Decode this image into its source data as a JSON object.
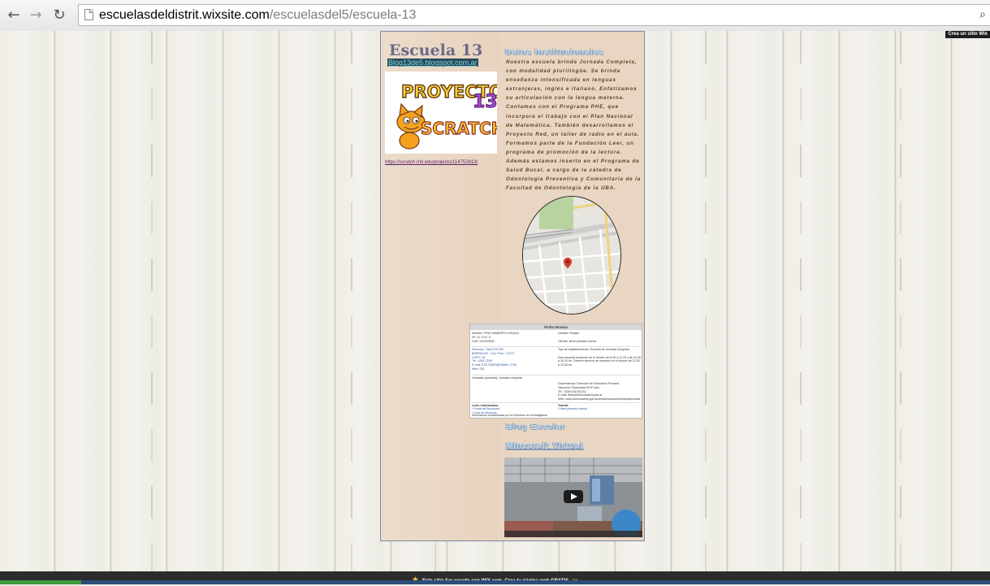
{
  "browser": {
    "back_icon": "arrow-left-icon",
    "forward_icon": "arrow-right-icon",
    "reload_icon": "reload-icon",
    "url_domain": "escuelasdeldistrit.wixsite.com",
    "url_path": "/escuelasdel5/escuela-13"
  },
  "site": {
    "title": "Escuela 13",
    "blog_link": "Blog13de5.blogspot.com.ar",
    "scratch_logo": {
      "line1": "PROYECTO",
      "number": "13",
      "line2": "SCRATCH"
    },
    "scratch_url": "https://scratch.mit.edu/projects/114752813/",
    "info_heading": "Datos institucionales",
    "description": "Nuestra escuela brinda Jornada Completa, con modalidad plurilingüe. Se brinda enseñanza intensificada en lenguas extranjeras, inglés e italiano. Enfatizamos su articulación con la lengua materna. Contamos con el Programa PHE, que incorpora el trabajo con el Plan Nacional de Matemática. También desarrollamos el Proyecto Red, un taller de radio en el aula. Formamos parte de la Fundación Leer, un programa de promoción de la lectura. Además estamos inserto en el Programa de Salud Bucal, a cargo de la cátedra de Odontología Preventiva y Comunitaria de la Facultad de Odontología de la UBA.",
    "map_pin_icon": "map-pin-icon",
    "ficha": {
      "header": "Ficha técnica",
      "left_top": "Nombre: FRAY MAMERTO ESQUIU\nNº: 13 / D.E. 5\nCUE: 020439000",
      "left_address": "Dirección: GALDOS 532\nBARRACAS - Cód. Post.: C1277\nCGPC: 04\nTel.: 4301-2299\nE-mail: ESC13DE5@GMAIL.COM\nWeb: S/D",
      "right_top": "Gestión: Estatal\n\nOfertas: Nivel primario común",
      "right_middle": "Tipo de establecimiento: Escuela de Jornada Completa\n\nEsta escuela funcionan en el horario de 8.15 a 12.20 y de 13.45 a 16.20 hs. Ofrecen servicio de comedor en el horario de 12.30 a 13.40 hs.",
      "left_jornada": "Jornadas (primaria): Jornada completa",
      "right_dependencia": "Dependencia: Dirección de Educación Primaria\nDirección: Esmeralda 55 8º piso\nTel.: 4339-1610/11/31\nE-mail: dnep@buenosaires.gob.ar\nWeb: www.buenosaires.gob.ar/areas/educacion/dirareaprimaria",
      "links_label": "Links relacionados",
      "links": "• Portal de Educación\n• Guía de Servicios",
      "tramites_label": "Trámite",
      "tramites": "• Nivel primario común",
      "footer": "Información suministrada por la Dirección de Investigación"
    },
    "blog_heading": "Blog Escolar",
    "video_heading": "Minecraft Virtual",
    "video_play_icon": "play-icon"
  },
  "wix_badge": "Crea un sitio Wix",
  "wix_banner": {
    "star_icon": "star-icon",
    "text": "Este sitio fue creado con WIX.com. Crea tu página web GRATIS",
    "cta": ">>"
  }
}
